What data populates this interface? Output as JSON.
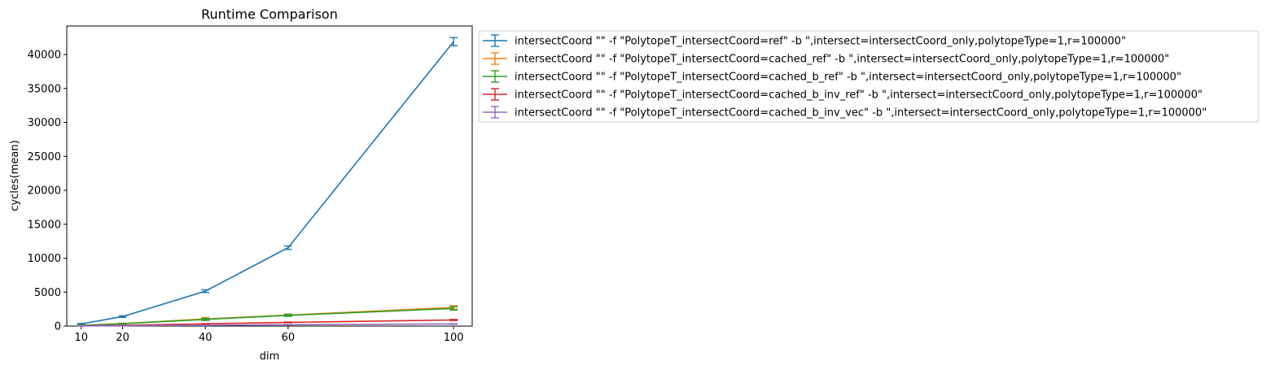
{
  "chart_data": {
    "type": "line",
    "title": "Runtime Comparison",
    "xlabel": "dim",
    "ylabel": "cycles(mean)",
    "x": [
      10,
      20,
      40,
      60,
      100
    ],
    "xticks": [
      10,
      20,
      40,
      60,
      100
    ],
    "yticks": [
      0,
      5000,
      10000,
      15000,
      20000,
      25000,
      30000,
      35000,
      40000
    ],
    "xlim": [
      6.5,
      104.5
    ],
    "ylim": [
      0,
      44200
    ],
    "grid": false,
    "legend_position": "outside-top-right",
    "series": [
      {
        "name": "intersectCoord \"\" -f \"PolytopeT_intersectCoord=ref\" -b \",intersect=intersectCoord_only,polytopeType=1,r=100000\"",
        "color": "#1f77b4",
        "values": [
          320,
          1400,
          5150,
          11550,
          41900
        ],
        "errors": [
          60,
          120,
          200,
          250,
          600
        ]
      },
      {
        "name": "intersectCoord \"\" -f \"PolytopeT_intersectCoord=cached_ref\" -b \",intersect=intersectCoord_only,polytopeType=1,r=100000\"",
        "color": "#ff7f0e",
        "values": [
          110,
          370,
          1050,
          1620,
          2750
        ],
        "errors": [
          30,
          50,
          200,
          150,
          250
        ]
      },
      {
        "name": "intersectCoord \"\" -f \"PolytopeT_intersectCoord=cached_b_ref\" -b \",intersect=intersectCoord_only,polytopeType=1,r=100000\"",
        "color": "#2ca02c",
        "values": [
          100,
          350,
          980,
          1580,
          2600
        ],
        "errors": [
          30,
          50,
          150,
          150,
          250
        ]
      },
      {
        "name": "intersectCoord \"\" -f \"PolytopeT_intersectCoord=cached_b_inv_ref\" -b \",intersect=intersectCoord_only,polytopeType=1,r=100000\"",
        "color": "#d62728",
        "values": [
          40,
          120,
          330,
          550,
          900
        ],
        "errors": [
          10,
          20,
          40,
          50,
          80
        ]
      },
      {
        "name": "intersectCoord \"\" -f \"PolytopeT_intersectCoord=cached_b_inv_vec\" -b \",intersect=intersectCoord_only,polytopeType=1,r=100000\"",
        "color": "#9467bd",
        "values": [
          20,
          50,
          120,
          200,
          320
        ],
        "errors": [
          5,
          10,
          20,
          30,
          40
        ]
      }
    ]
  }
}
